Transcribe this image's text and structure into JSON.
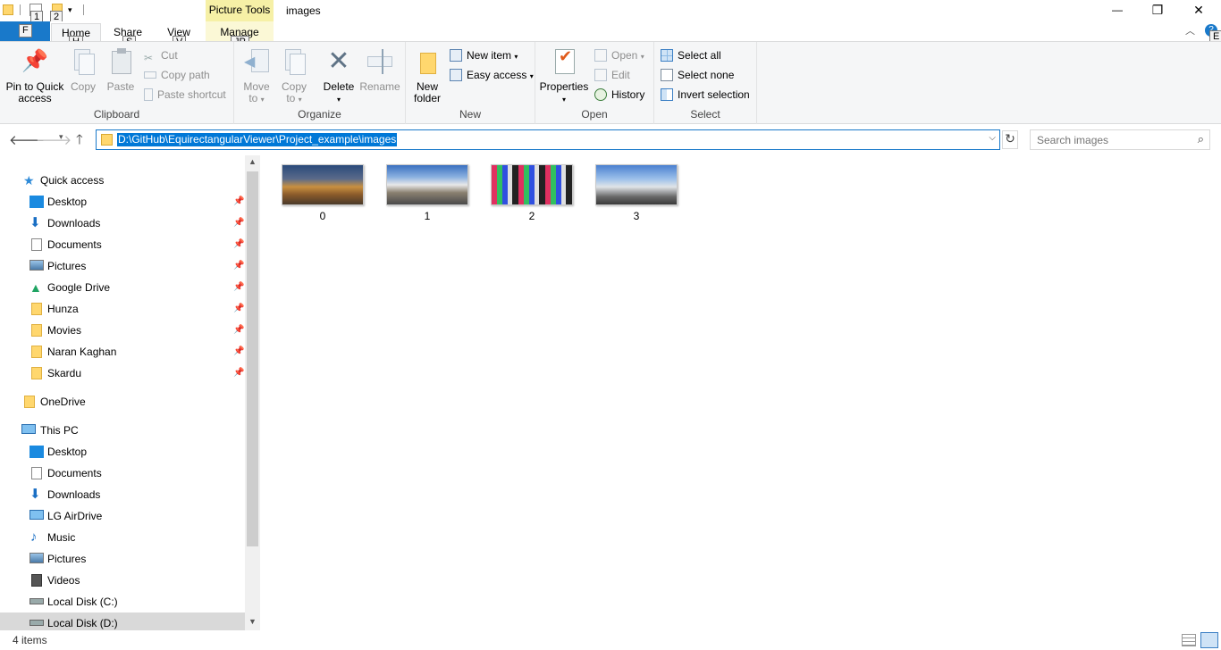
{
  "title_bar": {
    "keytips": [
      "1",
      "2"
    ],
    "contextual_tab": "Picture Tools",
    "window_title": "images",
    "minimize_glyph": "—",
    "restore_glyph": "❐",
    "close_glyph": "✕"
  },
  "tabs": {
    "file_keytip": "F",
    "home": "Home",
    "home_keytip": "H",
    "share": "Share",
    "share_keytip": "S",
    "view": "View",
    "view_keytip": "V",
    "manage": "Manage",
    "manage_keytip": "JP",
    "help_keytip": "E"
  },
  "ribbon": {
    "clipboard": {
      "label": "Clipboard",
      "pin_line1": "Pin to Quick",
      "pin_line2": "access",
      "copy": "Copy",
      "paste": "Paste",
      "cut": "Cut",
      "copy_path": "Copy path",
      "paste_shortcut": "Paste shortcut"
    },
    "organize": {
      "label": "Organize",
      "move_to_line1": "Move",
      "move_to_line2": "to",
      "copy_to_line1": "Copy",
      "copy_to_line2": "to",
      "delete": "Delete",
      "rename": "Rename"
    },
    "new": {
      "label": "New",
      "new_folder_line1": "New",
      "new_folder_line2": "folder",
      "new_item": "New item",
      "easy_access": "Easy access"
    },
    "open": {
      "label": "Open",
      "properties": "Properties",
      "open": "Open",
      "edit": "Edit",
      "history": "History"
    },
    "select": {
      "label": "Select",
      "select_all": "Select all",
      "select_none": "Select none",
      "invert_selection": "Invert selection"
    }
  },
  "address_bar": {
    "path": "D:\\GitHub\\EquirectangularViewer\\Project_example\\images",
    "search_placeholder": "Search images"
  },
  "nav_pane": {
    "quick_access": "Quick access",
    "quick_items": [
      {
        "label": "Desktop",
        "icon": "desktop-icon"
      },
      {
        "label": "Downloads",
        "icon": "download-arrow-icon"
      },
      {
        "label": "Documents",
        "icon": "document-icon"
      },
      {
        "label": "Pictures",
        "icon": "pictures-icon"
      },
      {
        "label": "Google Drive",
        "icon": "google-drive-icon"
      },
      {
        "label": "Hunza",
        "icon": "folder-icon"
      },
      {
        "label": "Movies",
        "icon": "folder-icon"
      },
      {
        "label": "Naran Kaghan",
        "icon": "folder-icon"
      },
      {
        "label": "Skardu",
        "icon": "folder-icon"
      }
    ],
    "onedrive": "OneDrive",
    "this_pc": "This PC",
    "pc_items": [
      {
        "label": "Desktop"
      },
      {
        "label": "Documents"
      },
      {
        "label": "Downloads"
      },
      {
        "label": "LG AirDrive"
      },
      {
        "label": "Music"
      },
      {
        "label": "Pictures"
      },
      {
        "label": "Videos"
      },
      {
        "label": "Local Disk (C:)"
      },
      {
        "label": "Local Disk (D:)"
      }
    ]
  },
  "files": [
    {
      "name": "0"
    },
    {
      "name": "1"
    },
    {
      "name": "2"
    },
    {
      "name": "3"
    }
  ],
  "status_bar": {
    "count": "4 items"
  },
  "colors": {
    "accent": "#1979ca",
    "selection": "#0078d7",
    "folder": "#ffd76e",
    "contextual_tab": "#f6f0a6"
  }
}
